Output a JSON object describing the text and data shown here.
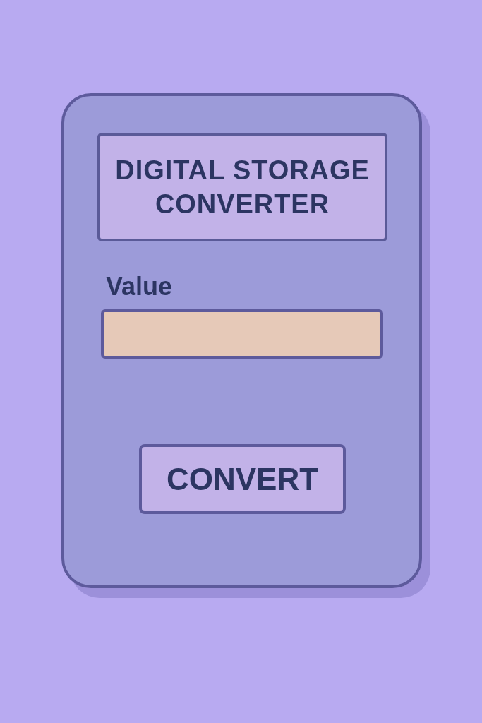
{
  "title": "DIGITAL STORAGE CONVERTER",
  "field": {
    "label": "Value"
  },
  "button": "CONVERT"
}
